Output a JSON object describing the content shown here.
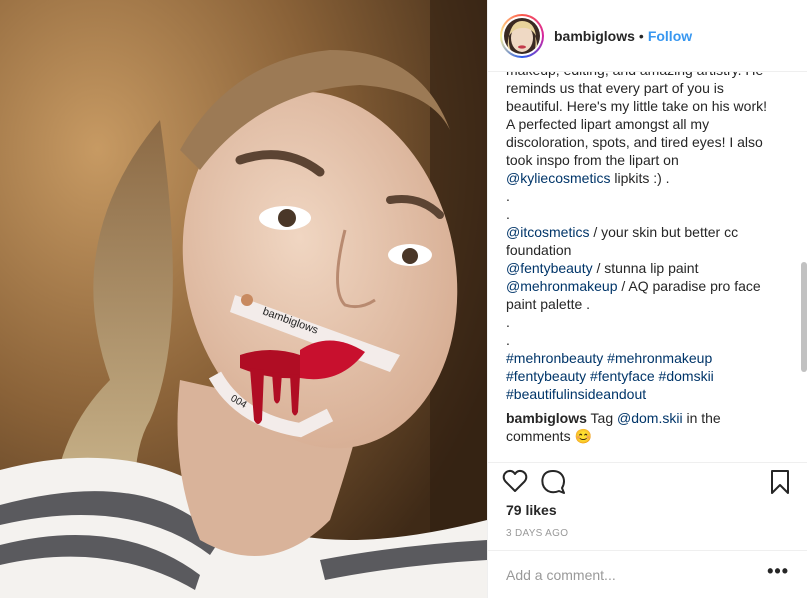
{
  "header": {
    "username": "bambiglows",
    "separator": "•",
    "follow_label": "Follow"
  },
  "photo": {
    "alt_icon": "selfie-photo",
    "band_text": "bambiglows",
    "band_text2": "004"
  },
  "caption": {
    "lines": [
      "makeup, editing, and amazing artistry. He reminds us that every part of you is beautiful. Here's my little take on his work! A perfected lipart amongst all my discoloration, spots, and tired eyes! I also took inspo from the lipart on",
      "lipkits :) ."
    ],
    "tag_kylie": "@kyliecosmetics",
    "dot1": ".",
    "dot2": ".",
    "tag_it": "@itcosmetics",
    "it_text": "/ your skin but better cc foundation",
    "tag_fenty": "@fentybeauty",
    "fenty_text": "/ stunna lip paint",
    "tag_mehron": "@mehronmakeup",
    "mehron_text": "/ AQ paradise pro face paint palette .",
    "dot3": ".",
    "dot4": ".",
    "hashtags": "#mehronbeauty #mehronmakeup #fentybeauty #fentyface #domskii #beautifulinsideandout"
  },
  "comment": {
    "username": "bambiglows",
    "text_before": "Tag",
    "mention": "@dom.skii",
    "text_after": "in the comments",
    "emoji": "😊"
  },
  "actions": {
    "like_icon": "heart-icon",
    "comment_icon": "comment-bubble-icon",
    "save_icon": "bookmark-icon"
  },
  "likes": "79 likes",
  "date": "3 DAYS AGO",
  "add_comment": {
    "placeholder": "Add a comment...",
    "more_label": "•••"
  },
  "colors": {
    "link": "#3897f0",
    "tag": "#003569",
    "muted": "#999999",
    "border": "#efefef"
  }
}
